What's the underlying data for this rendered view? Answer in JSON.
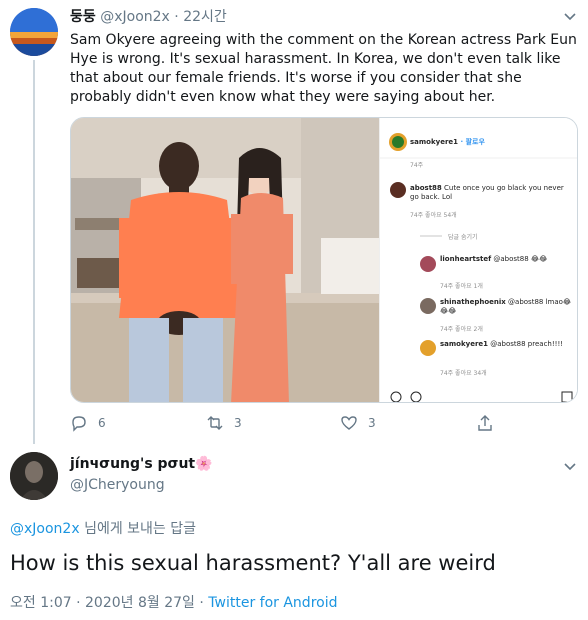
{
  "tweet": {
    "author_name": "둥둥",
    "handle": "@xJoon2x",
    "separator": "·",
    "time": "22시간",
    "text": "Sam Okyere agreeing with the comment on the Korean actress Park Eun Hye is wrong. It's sexual harassment. In Korea, we don't even talk like that about our female friends. It's worse if you consider that she probably didn't even know what they were saying about her.",
    "counts": {
      "replies": "6",
      "retweets": "3",
      "likes": "3"
    },
    "instagram": {
      "username": "samokyere1",
      "follow": "· 팔로우",
      "age_top": "74주",
      "comments": [
        {
          "user": "abost88",
          "text": "Cute once you go black you never go back. Lol",
          "meta": "74주  좋아요 54개"
        },
        {
          "user": "",
          "text": "답글 숨기기",
          "meta": ""
        },
        {
          "user": "lionheartstef",
          "text": "@abost88 😂😂",
          "meta": "74주  좋아요 1개"
        },
        {
          "user": "shinathephoenix",
          "text": "@abost88 lmao😂😂😂",
          "meta": "74주  좋아요 2개"
        },
        {
          "user": "samokyere1",
          "text": "@abost88 preach!!!!",
          "meta": "74주  좋아요 34개"
        }
      ]
    }
  },
  "reply": {
    "author_name": "jínчσung's pσut🌸",
    "handle": "@JCheryoung",
    "replying_to_handle": "@xJoon2x",
    "replying_to_suffix": " 님에게 보내는 답글",
    "text": "How is this sexual harassment? Y'all are weird",
    "time": "오전 1:07",
    "date": "2020년 8월 27일",
    "separator": "·",
    "source": "Twitter for Android"
  },
  "colors": {
    "accent": "#1b95e0",
    "muted": "#657786",
    "text": "#14171a",
    "divider": "#ccd6dd"
  }
}
